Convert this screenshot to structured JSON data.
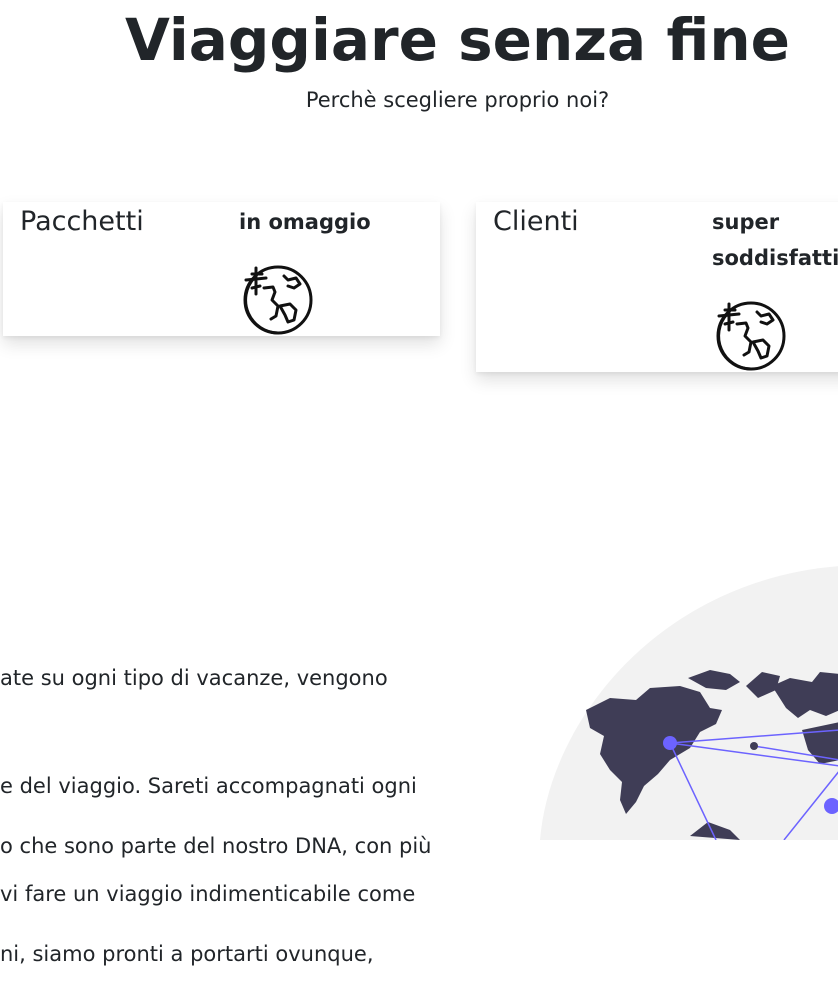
{
  "hero": {
    "title": "Viaggiare senza fine",
    "subtitle": "Perchè scegliere proprio noi?"
  },
  "cards": [
    {
      "title": "Pacchetti",
      "tag": "in omaggio",
      "icon": "globe-plane-icon"
    },
    {
      "title": "Clienti",
      "tag_line1": "super",
      "tag_line2": "soddisfatti",
      "icon": "globe-plane-icon"
    }
  ],
  "about": {
    "paragraph1": [
      "ate su ogni tipo di vacanze, vengono",
      "e del viaggio. Sareti accompagnati ogni",
      "vi fare un viaggio indimenticabile come"
    ],
    "paragraph2": [
      "o che sono parte del nostro DNA, con più",
      "ni, siamo pronti a portarti ovunque,"
    ]
  },
  "colors": {
    "text": "#212529",
    "map_land": "#3f3d56",
    "map_bg": "#f2f2f2",
    "map_accent": "#6c63ff"
  }
}
